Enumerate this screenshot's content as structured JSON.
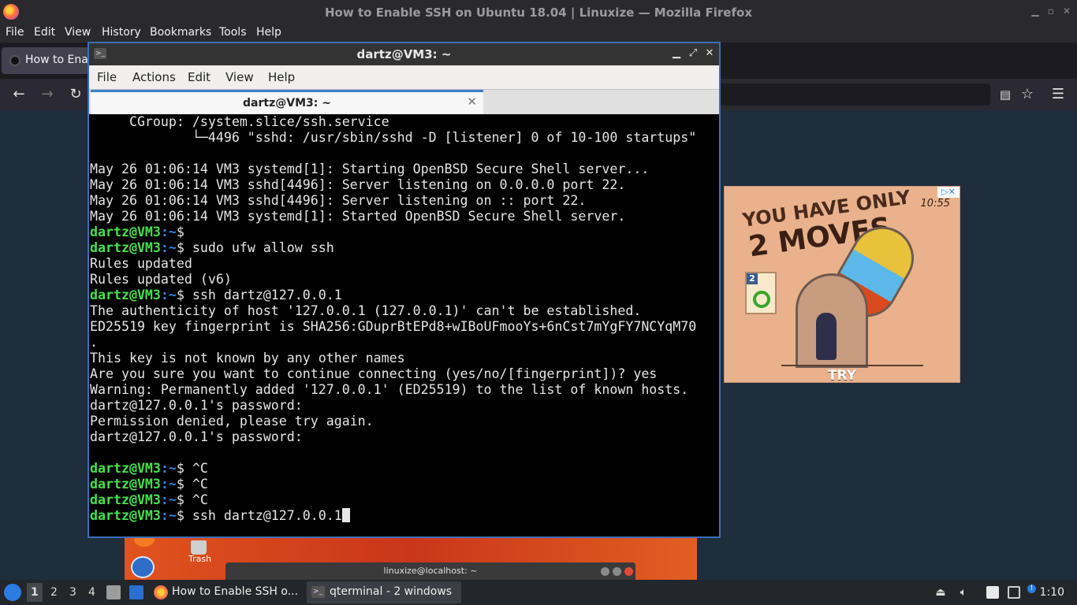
{
  "firefox": {
    "window_title": "How to Enable SSH on Ubuntu 18.04 | Linuxize — Mozilla Firefox",
    "menu": [
      "File",
      "Edit",
      "View",
      "History",
      "Bookmarks",
      "Tools",
      "Help"
    ],
    "tab_title": "How to Enal",
    "icons": [
      "back-icon",
      "forward-icon",
      "reload-icon",
      "reader-view-icon",
      "bookmark-star-icon",
      "hamburger-menu-icon"
    ]
  },
  "ad": {
    "headline_line1": "YOU HAVE ONLY",
    "headline_line2": "2 MOVES",
    "timer": "10:55",
    "level": "2",
    "cta": "TRY",
    "close_label": "▷✕"
  },
  "terminal": {
    "window_title": "dartz@VM3: ~",
    "menu": [
      "File",
      "Actions",
      "Edit",
      "View",
      "Help"
    ],
    "tab_label": "dartz@VM3: ~",
    "prompt_user": "dartz@VM3",
    "prompt_path": ":~",
    "prompt_symbol": "$ ",
    "lines": [
      {
        "kind": "text",
        "text": "     CGroup: /system.slice/ssh.service"
      },
      {
        "kind": "text",
        "text": "             └─4496 \"sshd: /usr/sbin/sshd -D [listener] 0 of 10-100 startups\""
      },
      {
        "kind": "text",
        "text": ""
      },
      {
        "kind": "text",
        "text": "May 26 01:06:14 VM3 systemd[1]: Starting OpenBSD Secure Shell server..."
      },
      {
        "kind": "text",
        "text": "May 26 01:06:14 VM3 sshd[4496]: Server listening on 0.0.0.0 port 22."
      },
      {
        "kind": "text",
        "text": "May 26 01:06:14 VM3 sshd[4496]: Server listening on :: port 22."
      },
      {
        "kind": "text",
        "text": "May 26 01:06:14 VM3 systemd[1]: Started OpenBSD Secure Shell server."
      },
      {
        "kind": "prompt",
        "text": ""
      },
      {
        "kind": "prompt",
        "text": "sudo ufw allow ssh"
      },
      {
        "kind": "text",
        "text": "Rules updated"
      },
      {
        "kind": "text",
        "text": "Rules updated (v6)"
      },
      {
        "kind": "prompt",
        "text": "ssh dartz@127.0.0.1"
      },
      {
        "kind": "text",
        "text": "The authenticity of host '127.0.0.1 (127.0.0.1)' can't be established."
      },
      {
        "kind": "text",
        "text": "ED25519 key fingerprint is SHA256:GDuprBtEPd8+wIBoUFmooYs+6nCst7mYgFY7NCYqM70"
      },
      {
        "kind": "text",
        "text": "."
      },
      {
        "kind": "text",
        "text": "This key is not known by any other names"
      },
      {
        "kind": "text",
        "text": "Are you sure you want to continue connecting (yes/no/[fingerprint])? yes"
      },
      {
        "kind": "text",
        "text": "Warning: Permanently added '127.0.0.1' (ED25519) to the list of known hosts."
      },
      {
        "kind": "text",
        "text": "dartz@127.0.0.1's password:"
      },
      {
        "kind": "text",
        "text": "Permission denied, please try again."
      },
      {
        "kind": "text",
        "text": "dartz@127.0.0.1's password:"
      },
      {
        "kind": "text",
        "text": ""
      },
      {
        "kind": "prompt",
        "text": "^C"
      },
      {
        "kind": "prompt",
        "text": "^C"
      },
      {
        "kind": "prompt",
        "text": "^C"
      },
      {
        "kind": "prompt",
        "text": "ssh dartz@127.0.0.1",
        "cursor": true
      }
    ]
  },
  "desktop": {
    "trash_label": "Trash",
    "bg_terminal_title": "linuxize@localhost: ~"
  },
  "taskbar": {
    "workspaces": [
      "1",
      "2",
      "3",
      "4"
    ],
    "active_workspace": "1",
    "tasks": [
      {
        "label": "How to Enable SSH o..."
      },
      {
        "label": "qterminal - 2 windows"
      }
    ],
    "clock": "1:10",
    "tray_icons": [
      "eject-icon",
      "volume-icon",
      "clipboard-icon",
      "network-icon",
      "notification-icon"
    ],
    "colors": {
      "accent": "#2a7de1"
    }
  }
}
